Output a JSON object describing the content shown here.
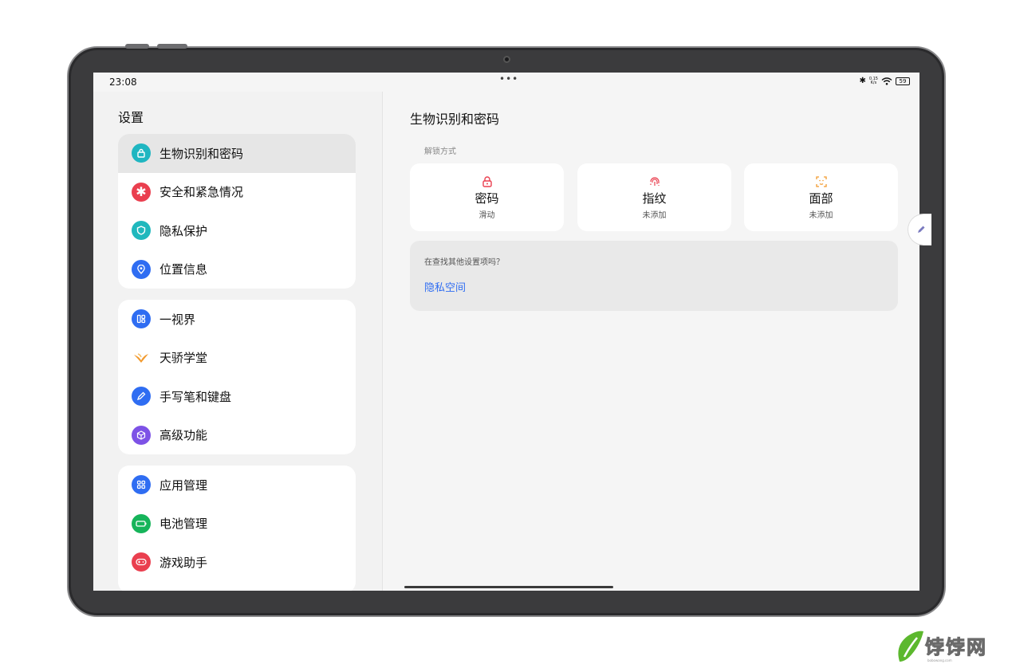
{
  "status": {
    "time": "23:08",
    "net_speed": "0.15\nK/s",
    "battery": "59",
    "menu_dots": "•••"
  },
  "left": {
    "title": "设置",
    "groups": [
      {
        "items": [
          {
            "label": "生物识别和密码",
            "icon": "lock-icon",
            "color": "#1fb6c1"
          },
          {
            "label": "安全和紧急情况",
            "icon": "asterisk-icon",
            "color": "#ea3f4f"
          },
          {
            "label": "隐私保护",
            "icon": "shield-icon",
            "color": "#20b8bd"
          },
          {
            "label": "位置信息",
            "icon": "location-pin-icon",
            "color": "#2f6df2"
          }
        ]
      },
      {
        "items": [
          {
            "label": "一视界",
            "icon": "split-view-icon",
            "color": "#2f6df2"
          },
          {
            "label": "天骄学堂",
            "icon": "bird-icon",
            "color": "#f29a2e"
          },
          {
            "label": "手写笔和键盘",
            "icon": "pen-icon",
            "color": "#2f6df2"
          },
          {
            "label": "高级功能",
            "icon": "cube-icon",
            "color": "#7d52e6"
          }
        ]
      },
      {
        "items": [
          {
            "label": "应用管理",
            "icon": "apps-grid-icon",
            "color": "#2f6df2"
          },
          {
            "label": "电池管理",
            "icon": "battery-icon",
            "color": "#16b45a"
          },
          {
            "label": "游戏助手",
            "icon": "gamepad-icon",
            "color": "#ea3f4f"
          }
        ]
      }
    ]
  },
  "right": {
    "title": "生物识别和密码",
    "section": "解锁方式",
    "cards": [
      {
        "title": "密码",
        "sub": "滑动",
        "icon": "lock-icon",
        "color": "#ea3f4f"
      },
      {
        "title": "指纹",
        "sub": "未添加",
        "icon": "fingerprint-icon",
        "color": "#ea3f4f"
      },
      {
        "title": "面部",
        "sub": "未添加",
        "icon": "face-scan-icon",
        "color": "#f29a2e"
      }
    ],
    "search": {
      "question": "在查找其他设置项吗？",
      "link": "隐私空间"
    }
  },
  "watermark": {
    "text": "饽饽网",
    "sub": "bobowang.com"
  }
}
